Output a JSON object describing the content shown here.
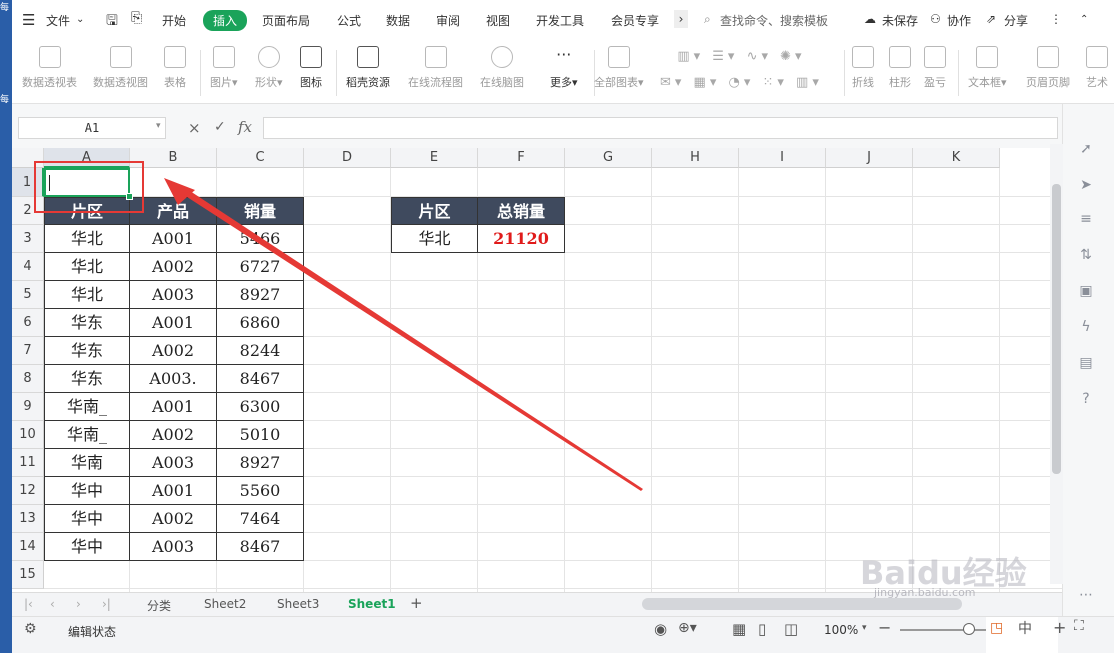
{
  "desktop": {
    "glyph_top": "每",
    "glyph_bottom": "每"
  },
  "menu": {
    "file": "文件",
    "items": [
      "开始",
      "插入",
      "页面布局",
      "公式",
      "数据",
      "审阅",
      "视图",
      "开发工具",
      "会员专享"
    ],
    "active_index": 1,
    "search": "查找命令、搜索模板",
    "unsaved": "未保存",
    "collab": "协作",
    "share": "分享"
  },
  "ribbon": {
    "buttons": [
      "数据透视表",
      "数据透视图",
      "表格",
      "图片",
      "形状",
      "图标",
      "稻壳资源",
      "在线流程图",
      "在线脑图",
      "更多",
      "全部图表",
      "折线",
      "柱形",
      "盈亏",
      "文本框",
      "页眉页脚",
      "艺术"
    ]
  },
  "formula": {
    "cell_ref": "A1",
    "fx": "fx",
    "cancel": "×",
    "confirm": "✓",
    "value": ""
  },
  "grid": {
    "columns": [
      "A",
      "B",
      "C",
      "D",
      "E",
      "F",
      "G",
      "H",
      "I",
      "J",
      "K"
    ],
    "rows": [
      "1",
      "2",
      "3",
      "4",
      "5",
      "6",
      "7",
      "8",
      "9",
      "10",
      "11",
      "12",
      "13",
      "14",
      "15"
    ],
    "table_headers": [
      "片区",
      "产品",
      "销量"
    ],
    "table_rows": [
      [
        "华北",
        "A001",
        "5466"
      ],
      [
        "华北",
        "A002",
        "6727"
      ],
      [
        "华北",
        "A003",
        "8927"
      ],
      [
        "华东",
        "A001",
        "6860"
      ],
      [
        "华东",
        "A002",
        "8244"
      ],
      [
        "华东",
        "A003.",
        "8467"
      ],
      [
        "华南_",
        "A001",
        "6300"
      ],
      [
        "华南_",
        "A002",
        "5010"
      ],
      [
        "华南",
        "A003",
        "8927"
      ],
      [
        "华中",
        "A001",
        "5560"
      ],
      [
        "华中",
        "A002",
        "7464"
      ],
      [
        "华中",
        "A003",
        "8467"
      ]
    ],
    "summary_headers": [
      "片区",
      "总销量"
    ],
    "summary_region": "华北",
    "summary_total": "21120",
    "summary_color": "#e01b1b",
    "annotation_color": "#e53935"
  },
  "sheets": {
    "tabs": [
      "分类",
      "Sheet2",
      "Sheet3",
      "Sheet1"
    ],
    "active": "Sheet1",
    "add": "+"
  },
  "status": {
    "mode": "编辑状态",
    "zoom": "100%"
  },
  "watermark": {
    "brand": "Baidu经验",
    "url": "jingyan.baidu.com"
  }
}
